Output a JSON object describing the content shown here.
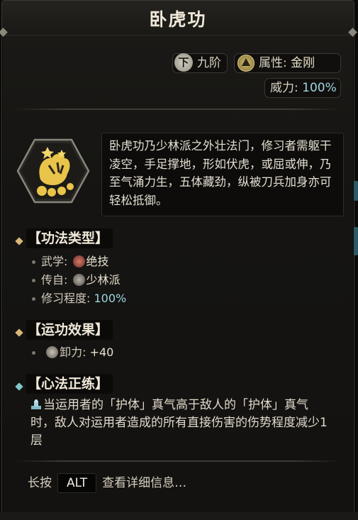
{
  "title": "卧虎功",
  "grade": {
    "icon_char": "下",
    "label": "九阶"
  },
  "attribute": {
    "label": "属性:",
    "value": "金刚",
    "icon": "vajra-emblem-icon"
  },
  "power": {
    "label": "威力:",
    "value": "100%"
  },
  "description": "卧虎功乃少林派之外壮法门，修习者需躯干凌空，手足撑地，形如伏虎，或屈或伸，乃至气涌力生，五体藏劲，纵被刀兵加身亦可轻松抵御。",
  "sections": {
    "type": {
      "title": "【功法类型】",
      "rows": [
        {
          "label": "武学:",
          "value": "绝技",
          "icon": "unique-skill-icon"
        },
        {
          "label": "传自:",
          "value": "少林派",
          "icon": "shaolin-sect-icon"
        },
        {
          "label": "修习程度:",
          "value": "100%"
        }
      ]
    },
    "effect": {
      "title": "【运功效果】",
      "rows": [
        {
          "label": "卸力:",
          "value": "+40",
          "icon": "deflect-icon"
        }
      ]
    },
    "mind": {
      "title": "【心法正练】",
      "text": "当运用者的「护体」真气高于敌人的「护体」真气时，敌人对运用者造成的所有直接伤害的伤势程度减少1层",
      "icon": "qi-body-icon"
    }
  },
  "footer": {
    "prefix": "长按",
    "key": "ALT",
    "suffix": "查看详细信息…"
  },
  "colors": {
    "accent_gold": "#d8b778",
    "accent_cyan": "#9fd4de",
    "emblem_gold": "#e9c44a"
  }
}
